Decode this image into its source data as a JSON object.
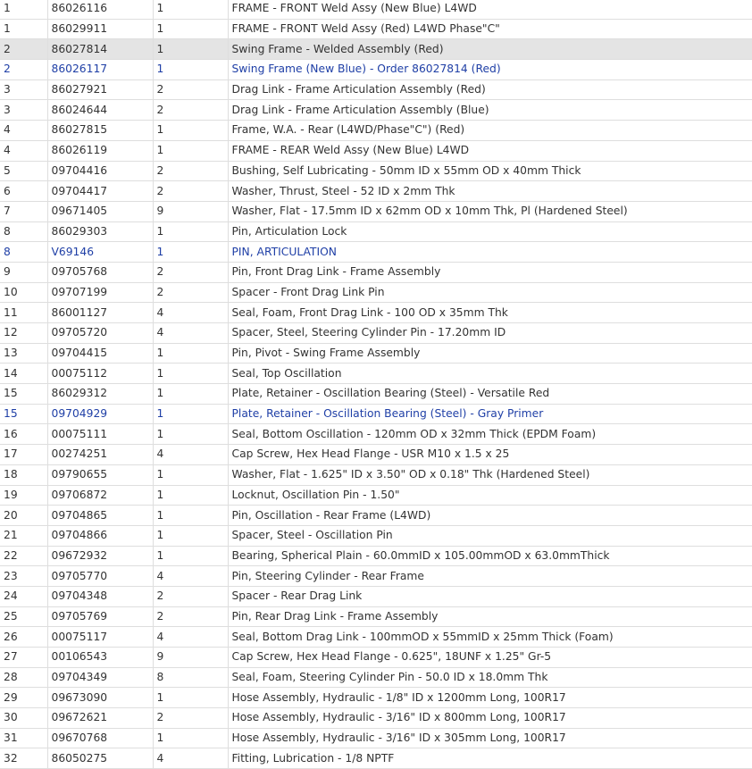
{
  "parts_table": {
    "highlight_color": "#e4e4e4",
    "link_color": "#1f3fa6",
    "rows": [
      {
        "ref": "1",
        "part_number": "86026116",
        "qty": "1",
        "description": "FRAME - FRONT Weld Assy (New Blue) L4WD"
      },
      {
        "ref": "1",
        "part_number": "86029911",
        "qty": "1",
        "description": "FRAME - FRONT Weld Assy (Red) L4WD Phase\"C\""
      },
      {
        "ref": "2",
        "part_number": "86027814",
        "qty": "1",
        "description": "Swing Frame - Welded Assembly (Red)"
      },
      {
        "ref": "2",
        "part_number": "86026117",
        "qty": "1",
        "description": "Swing Frame (New Blue) - Order 86027814 (Red)"
      },
      {
        "ref": "3",
        "part_number": "86027921",
        "qty": "2",
        "description": "Drag Link - Frame Articulation Assembly (Red)"
      },
      {
        "ref": "3",
        "part_number": "86024644",
        "qty": "2",
        "description": "Drag Link - Frame Articulation Assembly (Blue)"
      },
      {
        "ref": "4",
        "part_number": "86027815",
        "qty": "1",
        "description": "Frame, W.A. - Rear (L4WD/Phase\"C\") (Red)"
      },
      {
        "ref": "4",
        "part_number": "86026119",
        "qty": "1",
        "description": "FRAME - REAR Weld Assy (New Blue) L4WD"
      },
      {
        "ref": "5",
        "part_number": "09704416",
        "qty": "2",
        "description": "Bushing, Self Lubricating - 50mm ID x 55mm OD x 40mm Thick"
      },
      {
        "ref": "6",
        "part_number": "09704417",
        "qty": "2",
        "description": "Washer, Thrust, Steel - 52 ID x 2mm Thk"
      },
      {
        "ref": "7",
        "part_number": "09671405",
        "qty": "9",
        "description": "Washer, Flat - 17.5mm ID x 62mm OD x 10mm Thk, Pl (Hardened Steel)"
      },
      {
        "ref": "8",
        "part_number": "86029303",
        "qty": "1",
        "description": "Pin, Articulation Lock"
      },
      {
        "ref": "8",
        "part_number": "V69146",
        "qty": "1",
        "description": "PIN, ARTICULATION"
      },
      {
        "ref": "9",
        "part_number": "09705768",
        "qty": "2",
        "description": "Pin, Front Drag Link - Frame Assembly"
      },
      {
        "ref": "10",
        "part_number": "09707199",
        "qty": "2",
        "description": "Spacer - Front Drag Link Pin"
      },
      {
        "ref": "11",
        "part_number": "86001127",
        "qty": "4",
        "description": "Seal, Foam, Front Drag Link - 100 OD x 35mm Thk"
      },
      {
        "ref": "12",
        "part_number": "09705720",
        "qty": "4",
        "description": "Spacer, Steel, Steering Cylinder Pin - 17.20mm ID"
      },
      {
        "ref": "13",
        "part_number": "09704415",
        "qty": "1",
        "description": "Pin, Pivot - Swing Frame Assembly"
      },
      {
        "ref": "14",
        "part_number": "00075112",
        "qty": "1",
        "description": "Seal, Top Oscillation"
      },
      {
        "ref": "15",
        "part_number": "86029312",
        "qty": "1",
        "description": "Plate, Retainer - Oscillation Bearing (Steel) - Versatile Red"
      },
      {
        "ref": "15",
        "part_number": "09704929",
        "qty": "1",
        "description": "Plate, Retainer - Oscillation Bearing (Steel) - Gray Primer"
      },
      {
        "ref": "16",
        "part_number": "00075111",
        "qty": "1",
        "description": "Seal, Bottom Oscillation - 120mm OD x 32mm Thick (EPDM Foam)"
      },
      {
        "ref": "17",
        "part_number": "00274251",
        "qty": "4",
        "description": "Cap Screw, Hex Head Flange - USR M10 x 1.5 x 25"
      },
      {
        "ref": "18",
        "part_number": "09790655",
        "qty": "1",
        "description": "Washer, Flat - 1.625\" ID x 3.50\" OD x 0.18\" Thk (Hardened Steel)"
      },
      {
        "ref": "19",
        "part_number": "09706872",
        "qty": "1",
        "description": "Locknut, Oscillation Pin - 1.50\""
      },
      {
        "ref": "20",
        "part_number": "09704865",
        "qty": "1",
        "description": "Pin, Oscillation - Rear Frame (L4WD)"
      },
      {
        "ref": "21",
        "part_number": "09704866",
        "qty": "1",
        "description": "Spacer, Steel - Oscillation Pin"
      },
      {
        "ref": "22",
        "part_number": "09672932",
        "qty": "1",
        "description": "Bearing, Spherical Plain - 60.0mmID x 105.00mmOD x 63.0mmThick"
      },
      {
        "ref": "23",
        "part_number": "09705770",
        "qty": "4",
        "description": "Pin, Steering Cylinder - Rear Frame"
      },
      {
        "ref": "24",
        "part_number": "09704348",
        "qty": "2",
        "description": "Spacer - Rear Drag Link"
      },
      {
        "ref": "25",
        "part_number": "09705769",
        "qty": "2",
        "description": "Pin, Rear Drag Link - Frame Assembly"
      },
      {
        "ref": "26",
        "part_number": "00075117",
        "qty": "4",
        "description": "Seal, Bottom Drag Link - 100mmOD x 55mmID x 25mm Thick (Foam)"
      },
      {
        "ref": "27",
        "part_number": "00106543",
        "qty": "9",
        "description": "Cap Screw, Hex Head Flange - 0.625\", 18UNF x 1.25\" Gr-5"
      },
      {
        "ref": "28",
        "part_number": "09704349",
        "qty": "8",
        "description": "Seal, Foam, Steering Cylinder Pin - 50.0 ID x 18.0mm Thk"
      },
      {
        "ref": "29",
        "part_number": "09673090",
        "qty": "1",
        "description": "Hose Assembly, Hydraulic - 1/8\" ID x 1200mm Long, 100R17"
      },
      {
        "ref": "30",
        "part_number": "09672621",
        "qty": "2",
        "description": "Hose Assembly, Hydraulic - 3/16\" ID x 800mm Long, 100R17"
      },
      {
        "ref": "31",
        "part_number": "09670768",
        "qty": "1",
        "description": "Hose Assembly, Hydraulic - 3/16\" ID x 305mm Long, 100R17"
      },
      {
        "ref": "32",
        "part_number": "86050275",
        "qty": "4",
        "description": "Fitting, Lubrication - 1/8 NPTF"
      }
    ]
  }
}
